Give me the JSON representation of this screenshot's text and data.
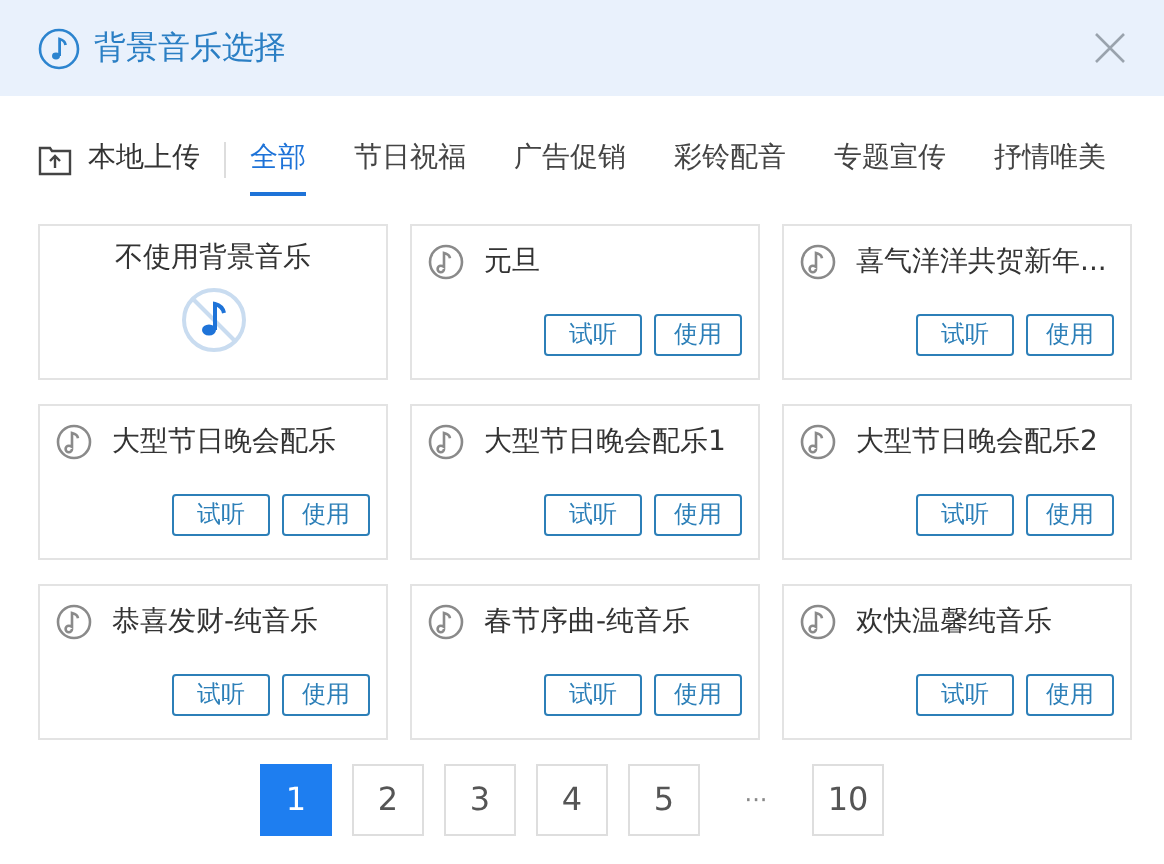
{
  "window": {
    "title": "背景音乐选择"
  },
  "upload": {
    "label": "本地上传"
  },
  "tabs": [
    {
      "label": "全部",
      "selected": true
    },
    {
      "label": "节日祝福",
      "selected": false
    },
    {
      "label": "广告促销",
      "selected": false
    },
    {
      "label": "彩铃配音",
      "selected": false
    },
    {
      "label": "专题宣传",
      "selected": false
    },
    {
      "label": "抒情唯美",
      "selected": false
    }
  ],
  "cards": [
    {
      "kind": "none",
      "title": "不使用背景音乐"
    },
    {
      "kind": "track",
      "title": "元旦",
      "preview": "试听",
      "use": "使用"
    },
    {
      "kind": "track",
      "title": "喜气洋洋共贺新年...",
      "preview": "试听",
      "use": "使用"
    },
    {
      "kind": "track",
      "title": "大型节日晚会配乐",
      "preview": "试听",
      "use": "使用"
    },
    {
      "kind": "track",
      "title": "大型节日晚会配乐1",
      "preview": "试听",
      "use": "使用"
    },
    {
      "kind": "track",
      "title": "大型节日晚会配乐2",
      "preview": "试听",
      "use": "使用"
    },
    {
      "kind": "track",
      "title": "恭喜发财-纯音乐",
      "preview": "试听",
      "use": "使用"
    },
    {
      "kind": "track",
      "title": "春节序曲-纯音乐",
      "preview": "试听",
      "use": "使用"
    },
    {
      "kind": "track",
      "title": "欢快温馨纯音乐",
      "preview": "试听",
      "use": "使用"
    }
  ],
  "pagination": [
    {
      "kind": "page",
      "label": "1",
      "selected": true
    },
    {
      "kind": "page",
      "label": "2",
      "selected": false
    },
    {
      "kind": "page",
      "label": "3",
      "selected": false
    },
    {
      "kind": "page",
      "label": "4",
      "selected": false
    },
    {
      "kind": "page",
      "label": "5",
      "selected": false
    },
    {
      "kind": "ellipsis",
      "label": "···"
    },
    {
      "kind": "page",
      "label": "10",
      "selected": false
    }
  ]
}
